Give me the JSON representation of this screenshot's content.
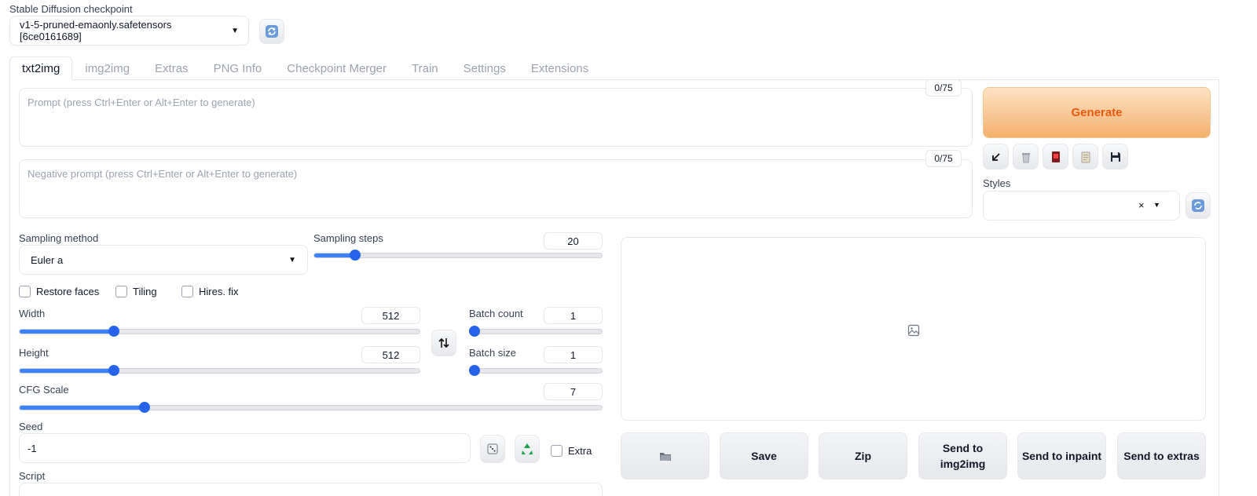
{
  "checkpoint": {
    "label": "Stable Diffusion checkpoint",
    "value": "v1-5-pruned-emaonly.safetensors [6ce0161689]",
    "refresh_icon": "refresh-icon"
  },
  "tabs": [
    {
      "label": "txt2img",
      "active": true
    },
    {
      "label": "img2img"
    },
    {
      "label": "Extras"
    },
    {
      "label": "PNG Info"
    },
    {
      "label": "Checkpoint Merger"
    },
    {
      "label": "Train"
    },
    {
      "label": "Settings"
    },
    {
      "label": "Extensions"
    }
  ],
  "prompt": {
    "placeholder": "Prompt (press Ctrl+Enter or Alt+Enter to generate)",
    "counter": "0/75"
  },
  "negative_prompt": {
    "placeholder": "Negative prompt (press Ctrl+Enter or Alt+Enter to generate)",
    "counter": "0/75"
  },
  "generate": {
    "label": "Generate",
    "accent": "#ea580c"
  },
  "tool_buttons": [
    "arrow-icon",
    "trash-icon",
    "red-card-icon",
    "clipboard-icon",
    "save-icon"
  ],
  "styles": {
    "label": "Styles",
    "clear": "×"
  },
  "sampling_method": {
    "label": "Sampling method",
    "value": "Euler a"
  },
  "sampling_steps": {
    "label": "Sampling steps",
    "value": "20",
    "fraction": 0.13
  },
  "checkboxes": [
    {
      "label": "Restore faces",
      "checked": false
    },
    {
      "label": "Tiling",
      "checked": false
    },
    {
      "label": "Hires. fix",
      "checked": false
    }
  ],
  "width": {
    "label": "Width",
    "value": "512",
    "fraction": 0.23
  },
  "height": {
    "label": "Height",
    "value": "512",
    "fraction": 0.23
  },
  "batch_count": {
    "label": "Batch count",
    "value": "1",
    "fraction": 0.0
  },
  "batch_size": {
    "label": "Batch size",
    "value": "1",
    "fraction": 0.0
  },
  "cfg_scale": {
    "label": "CFG Scale",
    "value": "7",
    "fraction": 0.21
  },
  "swap_icon": "swap-icon",
  "seed": {
    "label": "Seed",
    "value": "-1",
    "extra_label": "Extra"
  },
  "script": {
    "label": "Script"
  },
  "output_buttons": [
    {
      "label": "",
      "icon": "folder-icon"
    },
    {
      "label": "Save"
    },
    {
      "label": "Zip"
    },
    {
      "label": "Send to img2img"
    },
    {
      "label": "Send to inpaint"
    },
    {
      "label": "Send to extras"
    }
  ],
  "colors": {
    "accent": "#3b82f6",
    "generate_gradient_start": "#fde3c5",
    "generate_gradient_end": "#f3b06c"
  }
}
